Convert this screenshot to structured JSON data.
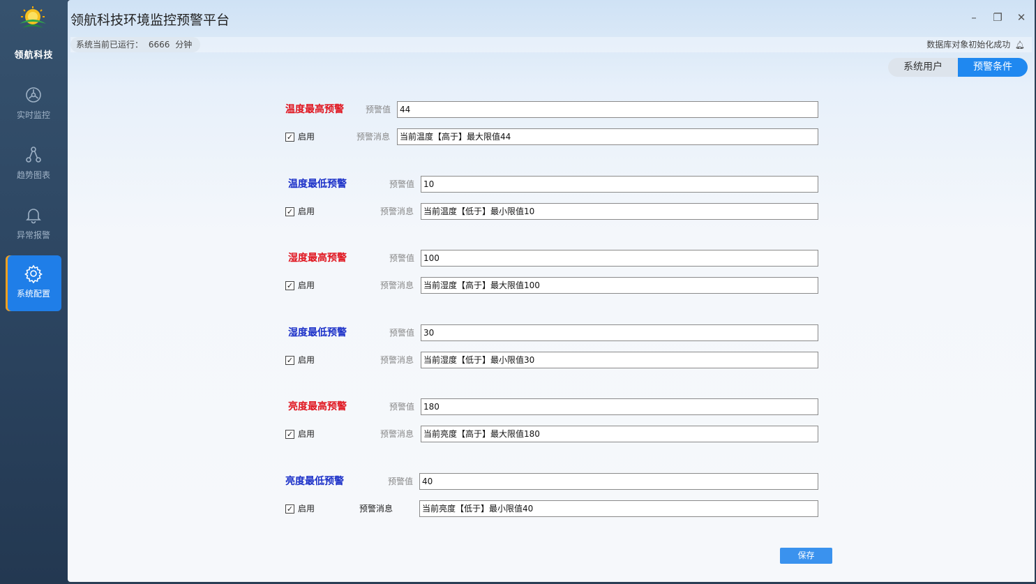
{
  "brand": {
    "name": "领航科技"
  },
  "sidebar": {
    "items": [
      {
        "label": "实时监控",
        "icon": "monitor-icon"
      },
      {
        "label": "趋势图表",
        "icon": "chart-nodes-icon"
      },
      {
        "label": "异常报警",
        "icon": "bell-icon"
      },
      {
        "label": "系统配置",
        "icon": "gear-icon",
        "active": true
      }
    ]
  },
  "window": {
    "title": "领航科技环境监控预警平台",
    "minimize": "–",
    "restore": "❐",
    "close": "✕"
  },
  "status": {
    "runtime_prefix": "系统当前已运行：",
    "runtime_value": "6666",
    "runtime_unit": "分钟",
    "db_message": "数据库对象初始化成功"
  },
  "tabs": [
    {
      "label": "系统用户",
      "active": false
    },
    {
      "label": "预警条件",
      "active": true
    }
  ],
  "alerts": [
    {
      "title": "温度最高预警",
      "color": "red",
      "value_label": "预警值",
      "value": "44",
      "enable_label": "启用",
      "enabled": true,
      "msg_label": "预警消息",
      "message": "当前温度【高于】最大限值44"
    },
    {
      "title": "温度最低预警",
      "color": "blue",
      "value_label": "预警值",
      "value": "10",
      "enable_label": "启用",
      "enabled": true,
      "msg_label": "预警消息",
      "message": "当前温度【低于】最小限值10"
    },
    {
      "title": "湿度最高预警",
      "color": "red",
      "value_label": "预警值",
      "value": "100",
      "enable_label": "启用",
      "enabled": true,
      "msg_label": "预警消息",
      "message": "当前湿度【高于】最大限值100"
    },
    {
      "title": "湿度最低预警",
      "color": "blue",
      "value_label": "预警值",
      "value": "30",
      "enable_label": "启用",
      "enabled": true,
      "msg_label": "预警消息",
      "message": "当前湿度【低于】最小限值30"
    },
    {
      "title": "亮度最高预警",
      "color": "red",
      "value_label": "预警值",
      "value": "180",
      "enable_label": "启用",
      "enabled": true,
      "msg_label": "预警消息",
      "message": "当前亮度【高于】最大限值180"
    },
    {
      "title": "亮度最低预警",
      "color": "blue",
      "value_label": "预警值",
      "value": "40",
      "enable_label": "启用",
      "enabled": true,
      "msg_label": "预警消息",
      "message": "当前亮度【低于】最小限值40"
    }
  ],
  "save_label": "保存",
  "colors": {
    "accent": "#1f88f0",
    "red_title": "#e0141e",
    "blue_title": "#1a2fc8",
    "sidebar": "#2c4561"
  }
}
